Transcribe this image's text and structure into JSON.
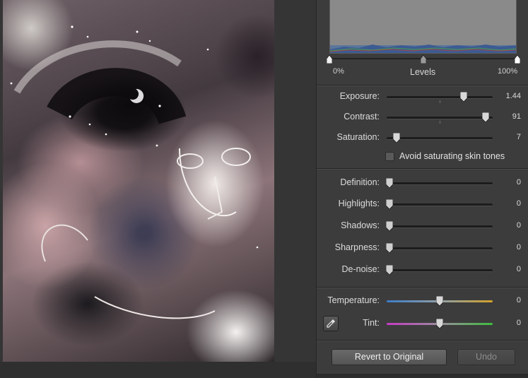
{
  "levels": {
    "label": "Levels",
    "min_label": "0%",
    "max_label": "100%"
  },
  "adjustments_top": [
    {
      "label": "Exposure:",
      "value": "1.44",
      "fraction": 0.74
    },
    {
      "label": "Contrast:",
      "value": "91",
      "fraction": 0.955
    },
    {
      "label": "Saturation:",
      "value": "7",
      "fraction": 0.07
    }
  ],
  "skin_tones": {
    "label": "Avoid saturating skin tones",
    "checked": false
  },
  "adjustments_detail": [
    {
      "label": "Definition:",
      "value": "0",
      "fraction": 0
    },
    {
      "label": "Highlights:",
      "value": "0",
      "fraction": 0
    },
    {
      "label": "Shadows:",
      "value": "0",
      "fraction": 0
    },
    {
      "label": "Sharpness:",
      "value": "0",
      "fraction": 0
    },
    {
      "label": "De-noise:",
      "value": "0",
      "fraction": 0
    }
  ],
  "adjustments_color": [
    {
      "label": "Temperature:",
      "value": "0",
      "fraction": 0.5
    },
    {
      "label": "Tint:",
      "value": "0",
      "fraction": 0.5
    }
  ],
  "buttons": {
    "revert": "Revert to Original",
    "undo": "Undo"
  },
  "colors": {
    "panel_bg": "#3c3c3c",
    "temperature_start": "#3d7ac5",
    "temperature_end": "#d3a22a",
    "tint_start": "#c43bc4",
    "tint_end": "#3ebd3e"
  },
  "icons": {
    "eyedropper": "eyedropper-icon"
  }
}
